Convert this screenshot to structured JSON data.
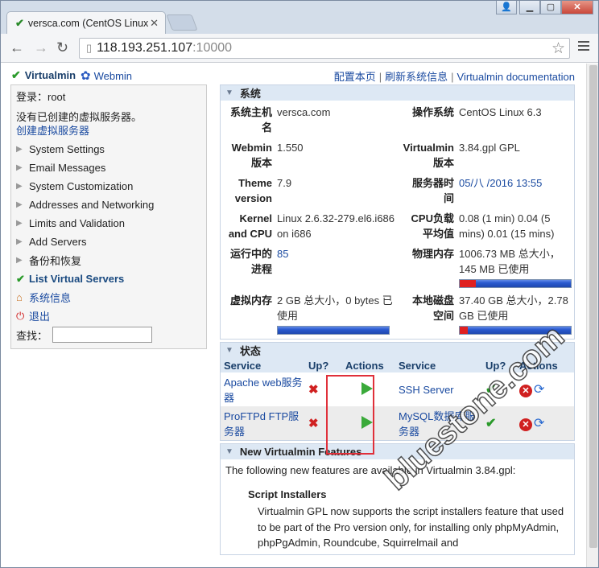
{
  "browser": {
    "tab_title": "versca.com (CentOS Linux",
    "url_host": "118.193.251.107",
    "url_port": ":10000"
  },
  "topbar": {
    "brand": "Virtualmin",
    "webmin": "Webmin",
    "link1": "配置本页",
    "link2": "刷新系统信息",
    "link3": "Virtualmin documentation"
  },
  "left": {
    "login": "登录：root",
    "no_hosts": "没有已创建的虚拟服务器。",
    "create_link": "创建虚拟服务器",
    "menu": [
      "System Settings",
      "Email Messages",
      "System Customization",
      "Addresses and Networking",
      "Limits and Validation",
      "Add Servers",
      "备份和恢复"
    ],
    "list_servers": "List Virtual Servers",
    "sysinfo": "系统信息",
    "logout": "退出",
    "search_label": "查找："
  },
  "system": {
    "title": "系统",
    "hostname_label": "系统主机名",
    "hostname": "versca.com",
    "os_label": "操作系统",
    "os": "CentOS Linux 6.3",
    "webmin_label": "Webmin 版本",
    "webmin_version": "1.550",
    "virtualmin_label": "Virtualmin 版本",
    "virtualmin_version": "3.84.gpl GPL",
    "theme_label": "Theme version",
    "theme_version": "7.9",
    "time_label": "服务器时间",
    "time": "05/八 /2016 13:55",
    "kernel_label": "Kernel and CPU",
    "kernel": "Linux 2.6.32-279.el6.i686 on i686",
    "load_label": "CPU负载平均值",
    "load": "0.08 (1 min) 0.04 (5 mins) 0.01 (15 mins)",
    "procs_label": "运行中的进程",
    "procs": "85",
    "mem_label": "物理内存",
    "mem": "1006.73 MB 总大小，145 MB 已使用",
    "mem_used_fraction": 0.144,
    "swap_label": "虚拟内存",
    "swap": "2 GB 总大小，0 bytes 已使用",
    "swap_used_fraction": 0,
    "disk_label": "本地磁盘空间",
    "disk": "37.40 GB 总大小，2.78 GB 已使用",
    "disk_used_fraction": 0.074
  },
  "status": {
    "title": "状态",
    "col_service": "Service",
    "col_up": "Up?",
    "col_actions": "Actions",
    "services_left": [
      "Apache web服务器",
      "ProFTPd FTP服务器"
    ],
    "services_right": [
      "SSH Server",
      "MySQL数据库服务器"
    ]
  },
  "features": {
    "title": "New Virtualmin Features",
    "intro": "The following new features are available in Virtualmin 3.84.gpl:",
    "heading": "Script Installers",
    "text": "Virtualmin GPL now supports the script installers feature that used to be part of the Pro version only, for installing only phpMyAdmin, phpPgAdmin, Roundcube, Squirrelmail and"
  },
  "watermark": "bluestone.com"
}
